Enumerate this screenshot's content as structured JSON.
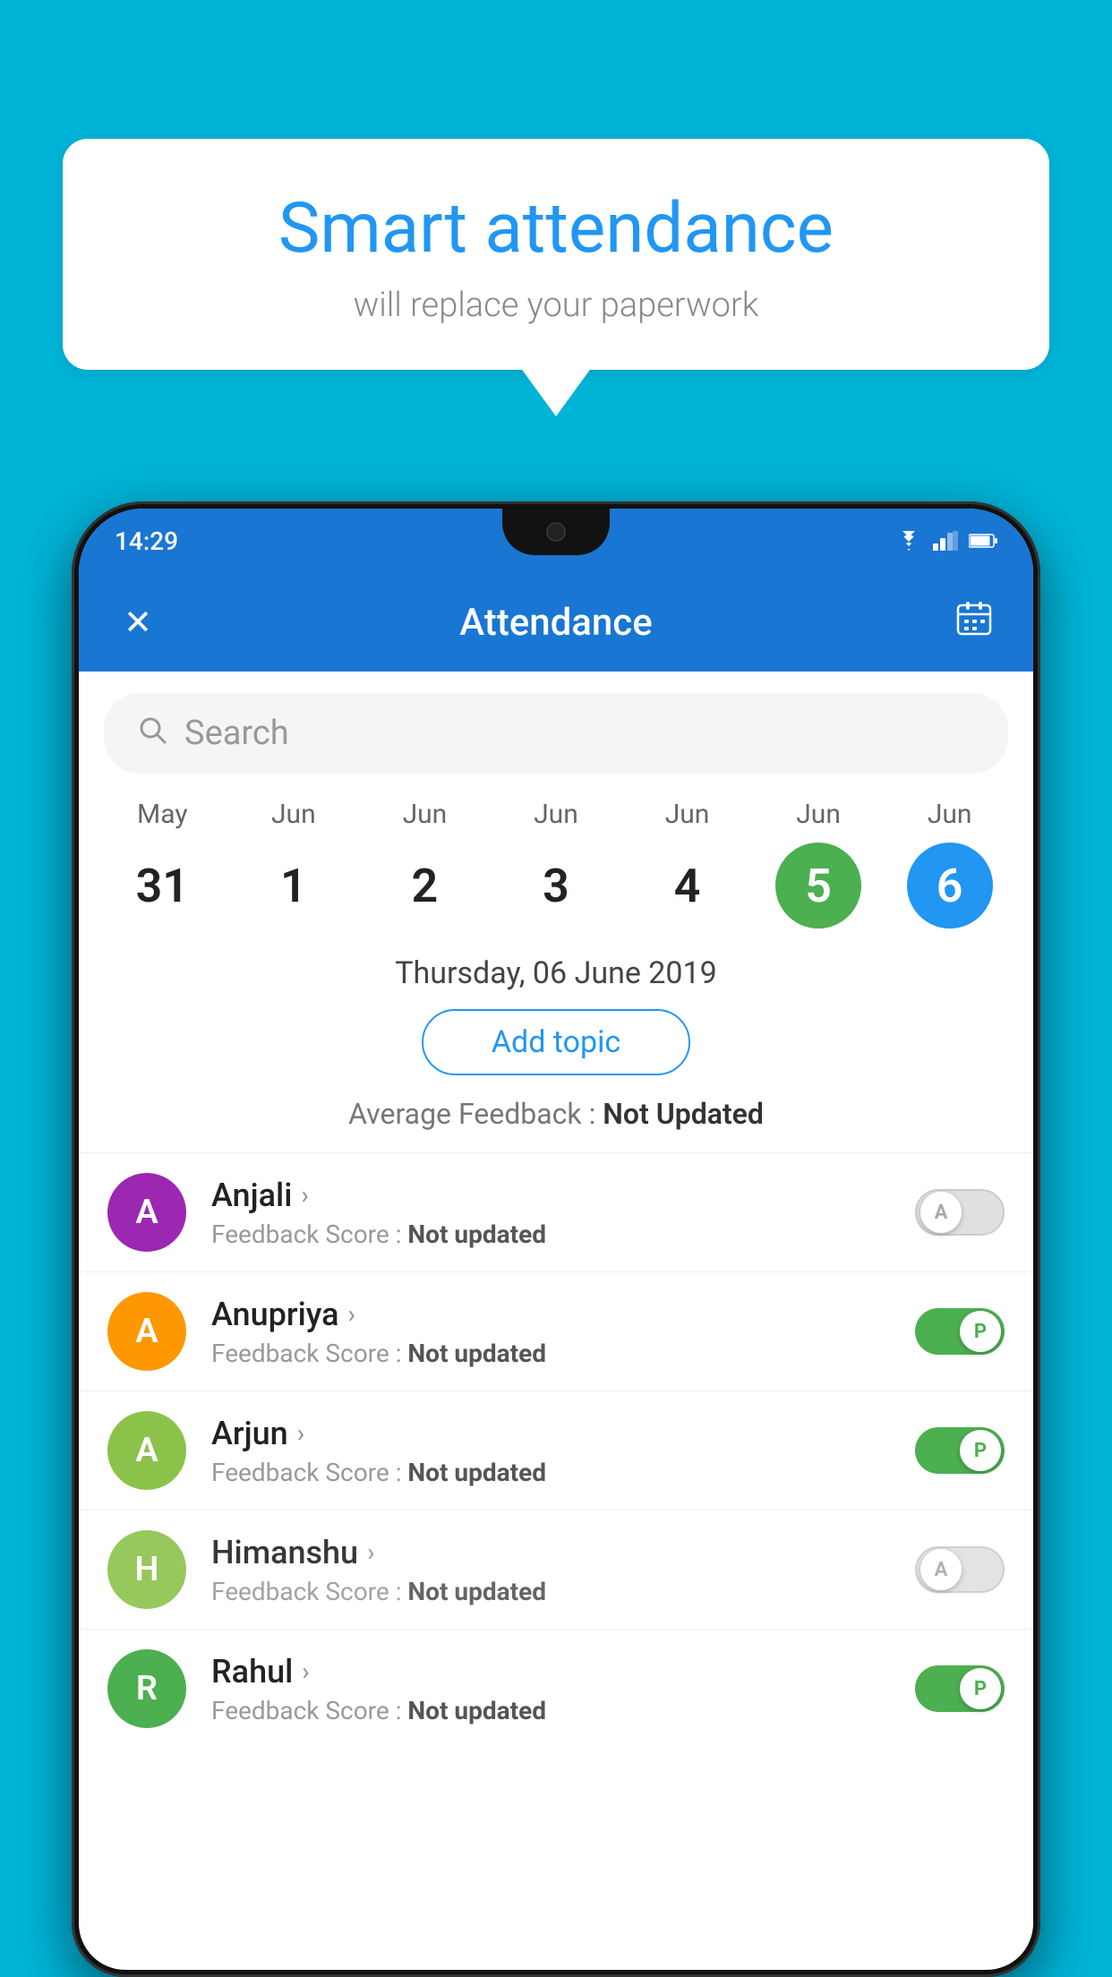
{
  "background_color": "#00b4d8",
  "bubble": {
    "title": "Smart attendance",
    "subtitle": "will replace your paperwork"
  },
  "status_bar": {
    "time": "14:29",
    "icons": [
      "wifi",
      "signal",
      "battery"
    ]
  },
  "app_bar": {
    "title": "Attendance",
    "close_icon": "✕",
    "calendar_icon": "📅"
  },
  "search": {
    "placeholder": "Search"
  },
  "date_strip": [
    {
      "month": "May",
      "day": "31",
      "state": "normal"
    },
    {
      "month": "Jun",
      "day": "1",
      "state": "normal"
    },
    {
      "month": "Jun",
      "day": "2",
      "state": "normal"
    },
    {
      "month": "Jun",
      "day": "3",
      "state": "normal"
    },
    {
      "month": "Jun",
      "day": "4",
      "state": "normal"
    },
    {
      "month": "Jun",
      "day": "5",
      "state": "today"
    },
    {
      "month": "Jun",
      "day": "6",
      "state": "selected"
    }
  ],
  "selected_date_label": "Thursday, 06 June 2019",
  "add_topic_label": "Add topic",
  "avg_feedback_label": "Average Feedback :",
  "avg_feedback_value": "Not Updated",
  "students": [
    {
      "name": "Anjali",
      "avatar_letter": "A",
      "avatar_color": "#9C27B0",
      "feedback_label": "Feedback Score :",
      "feedback_value": "Not updated",
      "toggle_state": "off",
      "toggle_label": "A"
    },
    {
      "name": "Anupriya",
      "avatar_letter": "A",
      "avatar_color": "#FF9800",
      "feedback_label": "Feedback Score :",
      "feedback_value": "Not updated",
      "toggle_state": "on",
      "toggle_label": "P"
    },
    {
      "name": "Arjun",
      "avatar_letter": "A",
      "avatar_color": "#8BC34A",
      "feedback_label": "Feedback Score :",
      "feedback_value": "Not updated",
      "toggle_state": "on",
      "toggle_label": "P"
    },
    {
      "name": "Himanshu",
      "avatar_letter": "H",
      "avatar_color": "#8BC34A",
      "feedback_label": "Feedback Score :",
      "feedback_value": "Not updated",
      "toggle_state": "off",
      "toggle_label": "A"
    },
    {
      "name": "Rahul",
      "avatar_letter": "R",
      "avatar_color": "#4CAF50",
      "feedback_label": "Feedback Score :",
      "feedback_value": "Not updated",
      "toggle_state": "on",
      "toggle_label": "P"
    }
  ]
}
